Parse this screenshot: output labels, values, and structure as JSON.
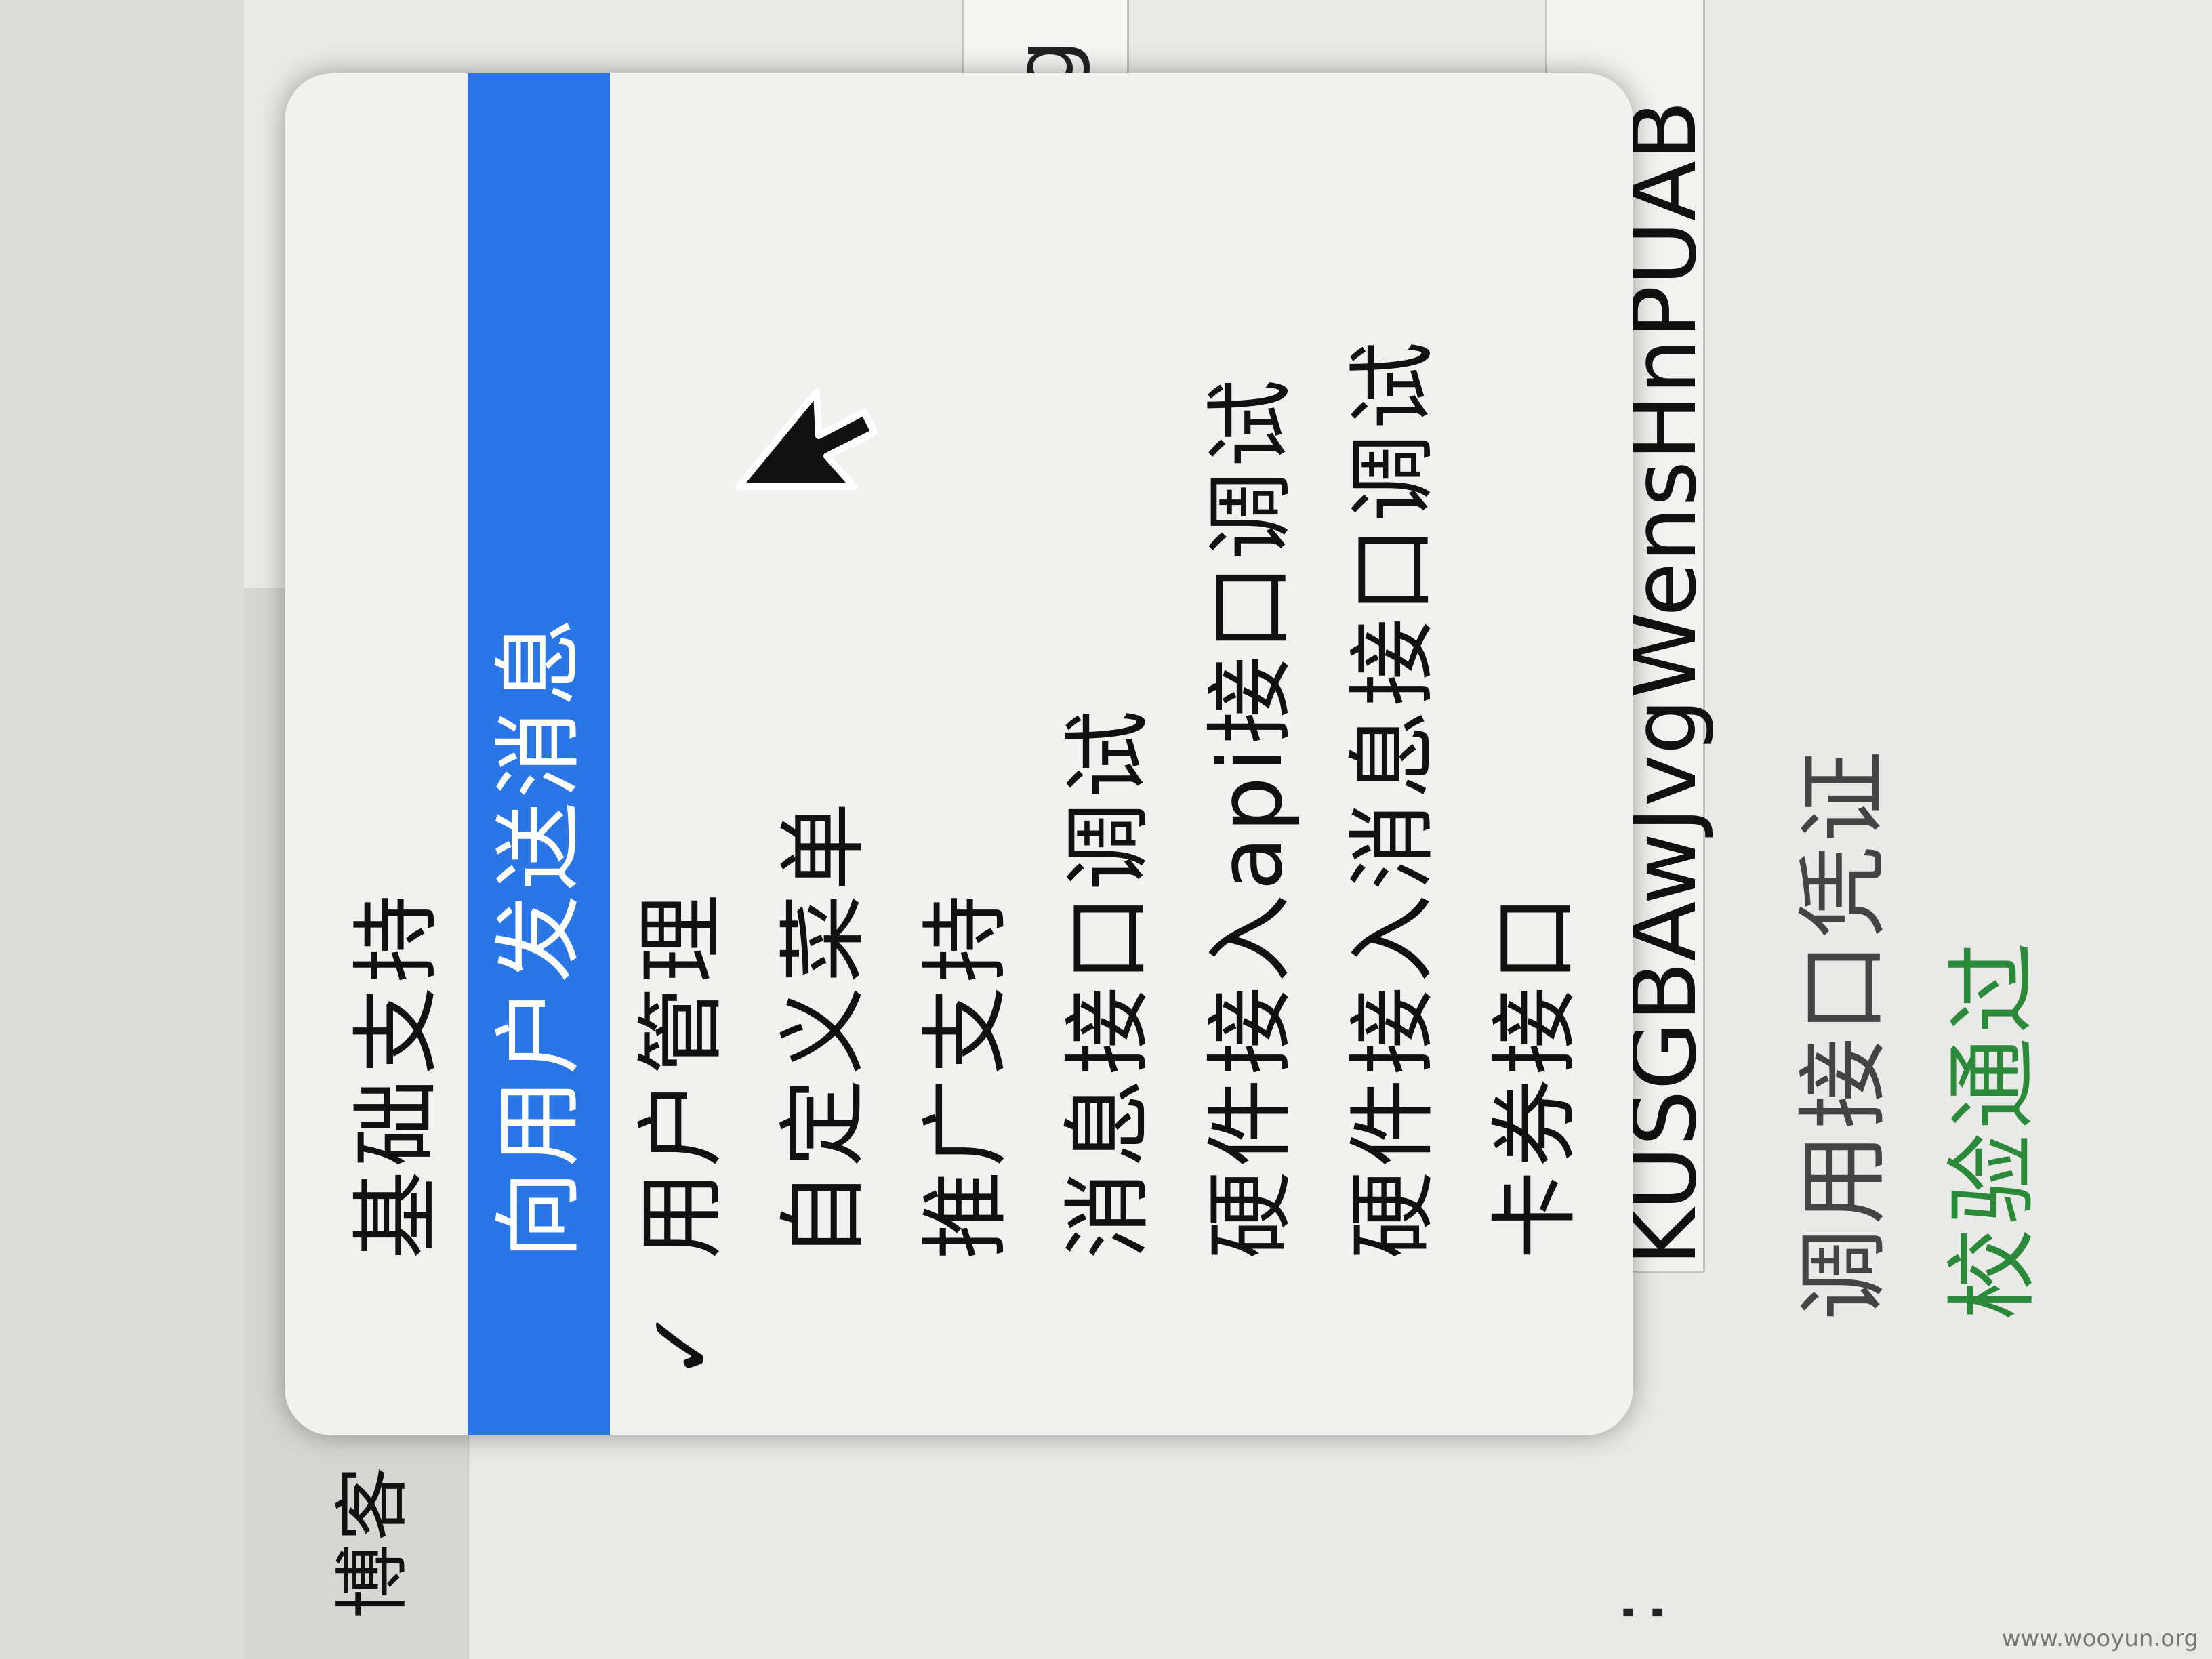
{
  "sidebar": {
    "blog_label": "博客",
    "colon": ":"
  },
  "menu": {
    "items": [
      {
        "label": "基础支持",
        "highlighted": false,
        "checked": false
      },
      {
        "label": "向用户发送消息",
        "highlighted": true,
        "checked": false
      },
      {
        "label": "用户管理",
        "highlighted": false,
        "checked": true
      },
      {
        "label": "自定义菜单",
        "highlighted": false,
        "checked": false
      },
      {
        "label": "推广支持",
        "highlighted": false,
        "checked": false
      },
      {
        "label": "消息接口调试",
        "highlighted": false,
        "checked": false
      },
      {
        "label": "硬件接入api接口调试",
        "highlighted": false,
        "checked": false
      },
      {
        "label": "硬件接入消息接口调试",
        "highlighted": false,
        "checked": false
      },
      {
        "label": "卡券接口",
        "highlighted": false,
        "checked": false
      }
    ],
    "check_glyph": "✓"
  },
  "form": {
    "url_partial": "/g",
    "token_value": "KUSGBAwJvgWensHnPUAB",
    "credential_label": "调用接口凭证",
    "verify_status": "校验通过"
  },
  "colors": {
    "highlight": "#2a76e6",
    "success": "#2a8a3a"
  },
  "watermark": "www.wooyun.org"
}
